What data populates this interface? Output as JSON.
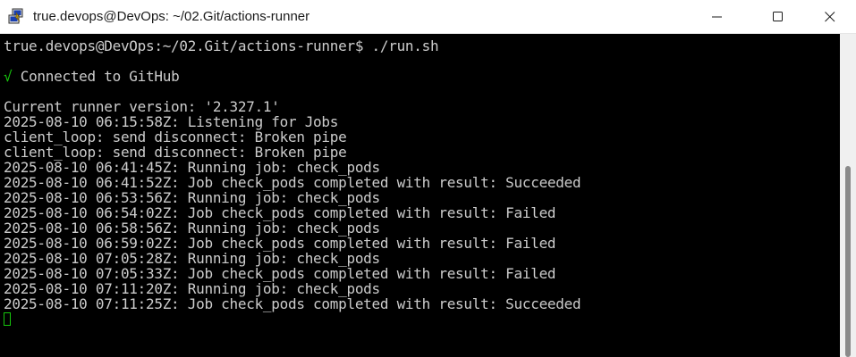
{
  "window": {
    "title": "true.devops@DevOps: ~/02.Git/actions-runner",
    "icon": "putty-terminal-icon",
    "controls": {
      "minimize_icon": "minimize-icon",
      "maximize_icon": "maximize-icon",
      "close_icon": "close-icon"
    }
  },
  "terminal": {
    "prompt_line": "true.devops@DevOps:~/02.Git/actions-runner$ ./run.sh",
    "connected_line": {
      "check": "√",
      "text": " Connected to GitHub"
    },
    "lines": [
      "Current runner version: '2.327.1'",
      "2025-08-10 06:15:58Z: Listening for Jobs",
      "client_loop: send disconnect: Broken pipe",
      "client_loop: send disconnect: Broken pipe",
      "2025-08-10 06:41:45Z: Running job: check_pods",
      "2025-08-10 06:41:52Z: Job check_pods completed with result: Succeeded",
      "2025-08-10 06:53:56Z: Running job: check_pods",
      "2025-08-10 06:54:02Z: Job check_pods completed with result: Failed",
      "2025-08-10 06:58:56Z: Running job: check_pods",
      "2025-08-10 06:59:02Z: Job check_pods completed with result: Failed",
      "2025-08-10 07:05:28Z: Running job: check_pods",
      "2025-08-10 07:05:33Z: Job check_pods completed with result: Failed",
      "2025-08-10 07:11:20Z: Running job: check_pods",
      "2025-08-10 07:11:25Z: Job check_pods completed with result: Succeeded"
    ]
  },
  "colors": {
    "background": "#000000",
    "foreground": "#cccccc",
    "success_green": "#16c60c"
  }
}
